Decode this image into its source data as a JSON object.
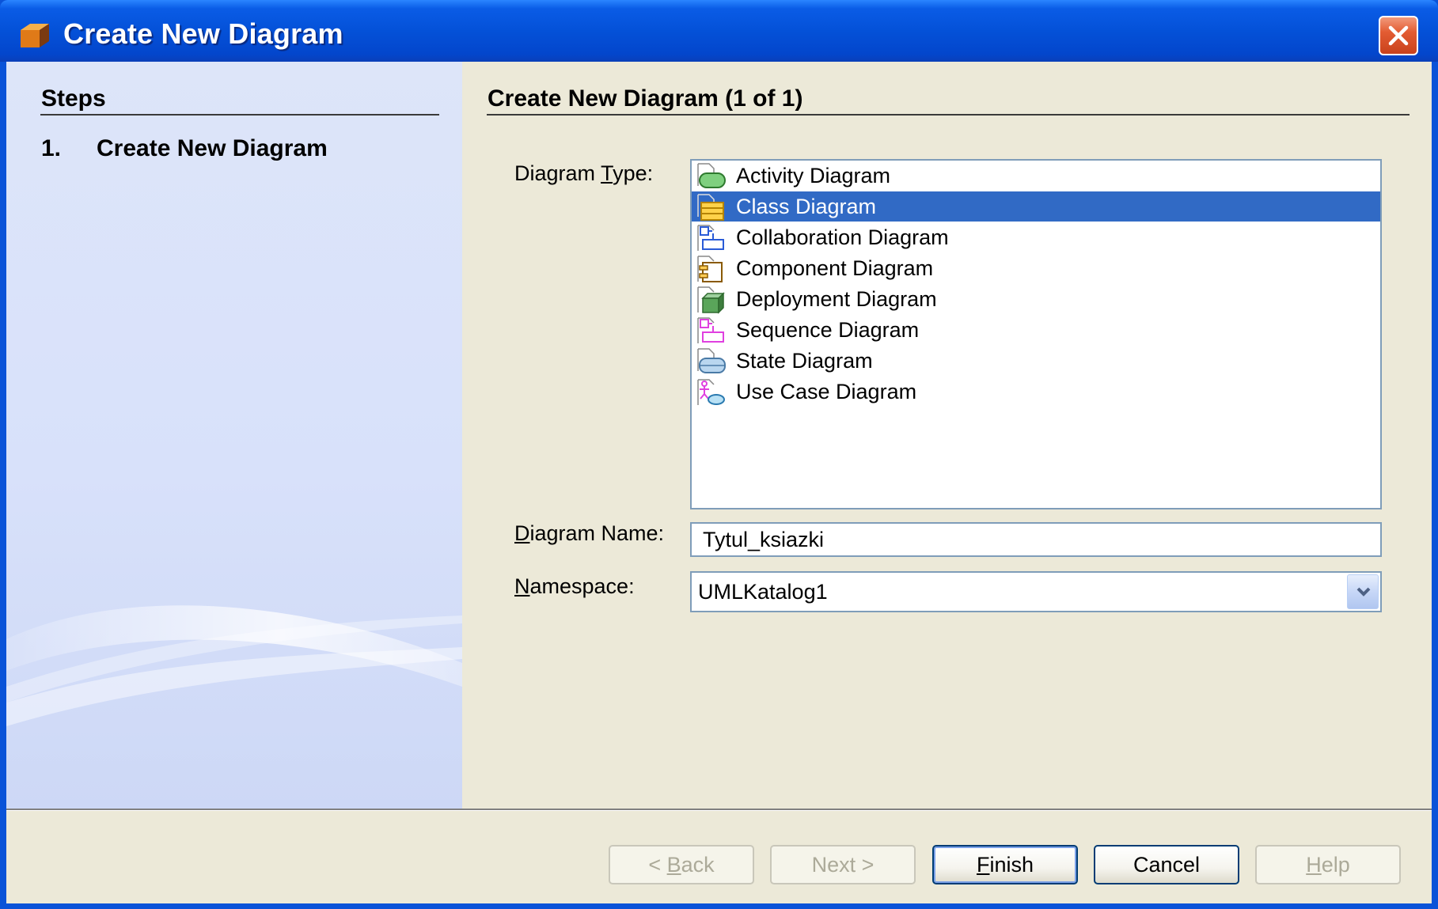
{
  "window": {
    "title": "Create New Diagram",
    "icon": "cube-icon"
  },
  "steps": {
    "title": "Steps",
    "items": [
      {
        "number": "1.",
        "label": "Create New Diagram"
      }
    ]
  },
  "main": {
    "title": "Create New Diagram (1 of 1)",
    "diagram_type_label": "Diagram Type:",
    "diagram_types": [
      {
        "label": "Activity Diagram",
        "icon": "activity-diagram-icon",
        "selected": false
      },
      {
        "label": "Class Diagram",
        "icon": "class-diagram-icon",
        "selected": true
      },
      {
        "label": "Collaboration Diagram",
        "icon": "collaboration-diagram-icon",
        "selected": false
      },
      {
        "label": "Component Diagram",
        "icon": "component-diagram-icon",
        "selected": false
      },
      {
        "label": "Deployment Diagram",
        "icon": "deployment-diagram-icon",
        "selected": false
      },
      {
        "label": "Sequence Diagram",
        "icon": "sequence-diagram-icon",
        "selected": false
      },
      {
        "label": "State Diagram",
        "icon": "state-diagram-icon",
        "selected": false
      },
      {
        "label": "Use Case Diagram",
        "icon": "use-case-diagram-icon",
        "selected": false
      }
    ],
    "diagram_name_label": "Diagram Name:",
    "diagram_name_value": "Tytul_ksiazki",
    "namespace_label": "Namespace:",
    "namespace_value": "UMLKatalog1"
  },
  "buttons": {
    "back": "< Back",
    "next": "Next >",
    "finish": "Finish",
    "cancel": "Cancel",
    "help": "Help"
  },
  "colors": {
    "titlebar": "#0451d8",
    "selection": "#316ac5",
    "dialog_bg": "#ece9d8",
    "steps_bg": "#d8e1fa"
  }
}
